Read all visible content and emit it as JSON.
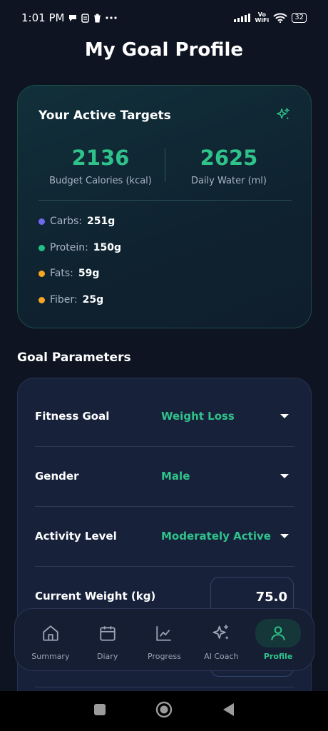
{
  "status_bar": {
    "time": "1:01 PM",
    "network_label_top": "Vo",
    "network_label_bottom": "WiFi",
    "battery": "32"
  },
  "page": {
    "title": "My Goal Profile"
  },
  "targets": {
    "title": "Your Active Targets",
    "calories": {
      "value": "2136",
      "label": "Budget Calories (kcal)"
    },
    "water": {
      "value": "2625",
      "label": "Daily Water (ml)"
    },
    "macros": [
      {
        "label": "Carbs:",
        "value": "251g",
        "color": "#6d6af0"
      },
      {
        "label": "Protein:",
        "value": "150g",
        "color": "#22c084"
      },
      {
        "label": "Fats:",
        "value": "59g",
        "color": "#f5a623"
      },
      {
        "label": "Fiber:",
        "value": "25g",
        "color": "#f5a623"
      }
    ]
  },
  "params": {
    "section_title": "Goal Parameters",
    "fitness_goal": {
      "label": "Fitness Goal",
      "value": "Weight Loss"
    },
    "gender": {
      "label": "Gender",
      "value": "Male"
    },
    "activity_level": {
      "label": "Activity Level",
      "value": "Moderately Active"
    },
    "current_weight": {
      "label": "Current Weight (kg)",
      "value": "75.0"
    }
  },
  "nav": {
    "items": [
      {
        "label": "Summary",
        "icon": "home-icon"
      },
      {
        "label": "Diary",
        "icon": "calendar-icon"
      },
      {
        "label": "Progress",
        "icon": "chart-icon"
      },
      {
        "label": "AI Coach",
        "icon": "sparkle-icon"
      },
      {
        "label": "Profile",
        "icon": "person-icon",
        "active": true
      }
    ]
  },
  "colors": {
    "accent": "#2fc28a",
    "background": "#0e1422",
    "card": "#17213a"
  }
}
